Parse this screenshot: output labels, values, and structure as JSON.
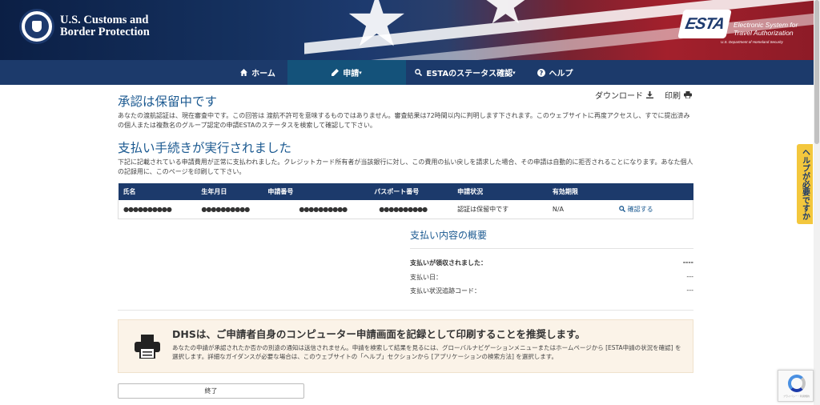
{
  "header": {
    "agency_line1": "U.S. Customs and",
    "agency_line2": "Border Protection",
    "esta_logo": "ESTA",
    "esta_line1": "Electronic System for",
    "esta_line2": "Travel Authorization",
    "esta_dhs": "U.S. Department of Homeland Security"
  },
  "nav": {
    "items": [
      {
        "label": "ホーム",
        "icon": "home-icon"
      },
      {
        "label": "申請",
        "icon": "pencil-icon"
      },
      {
        "label": "ESTAのステータス確認",
        "icon": "search-icon"
      },
      {
        "label": "ヘルプ",
        "icon": "question-icon"
      }
    ]
  },
  "side_help": "ヘルプが必要ですか",
  "tools": {
    "download": "ダウンロード",
    "print": "印刷"
  },
  "section1": {
    "title": "承認は保留中です",
    "text": "あなたの渡航認証は、現在審査中です。この回答は 渡航不許可を意味するものではありません。審査結果は72時間以内に判明します下されます。このウェブサイトに再度アクセスし、すでに提出済みの個人または複数名のグループ認定の申請ESTAのステータスを検索して確認して下さい。"
  },
  "section2": {
    "title": "支払い手続きが実行されました",
    "text": "下記に記載されている申請費用が正常に支払われました。クレジットカード所有者が当該銀行に対し、この費用の払い戻しを請求した場合、その申請は自動的に拒否されることになります。あなた個人の記録用に、このページを印刷して下さい。"
  },
  "table": {
    "headers": [
      "氏名",
      "生年月日",
      "申請番号",
      "パスポート番号",
      "申請状況",
      "有効期限",
      ""
    ],
    "row": {
      "name": "●●●●●●●●●●",
      "dob": "●●●●●●●●●●",
      "app_no": "●●●●●●●●●●",
      "passport": "●●●●●●●●●●",
      "status": "認証は保留中です",
      "expiry": "N/A",
      "action": "確認する"
    }
  },
  "summary": {
    "title": "支払い内容の概要",
    "rows": [
      {
        "label": "支払いが領収されました：",
        "value": "----"
      },
      {
        "label": "支払い日：",
        "value": "---"
      },
      {
        "label": "支払い状況追跡コード：",
        "value": "---"
      }
    ]
  },
  "notice": {
    "title": "DHSは、ご申請者自身のコンピューター申請画面を記録として印刷することを推奨します。",
    "text": "あなたの申請が承認されたか否かの別途の通知は送信されません。申請を検索して結果を見るには、グローバルナビゲーションメニューまたはホームページから [ESTA申請の状況を確認] を選択します。詳細なガイダンスが必要な場合は、このウェブサイトの「ヘルプ」セクションから [アプリケーションの検索方法] を選択します。"
  },
  "buttons": {
    "end": "終了"
  },
  "recaptcha": "プライバシー・利用規約",
  "colors": {
    "nav_bg": "#1c3a6b",
    "nav_active": "#14527a",
    "heading": "#1c5a91",
    "help_tab": "#f3c73d",
    "notice_bg": "#fbf3e8"
  }
}
